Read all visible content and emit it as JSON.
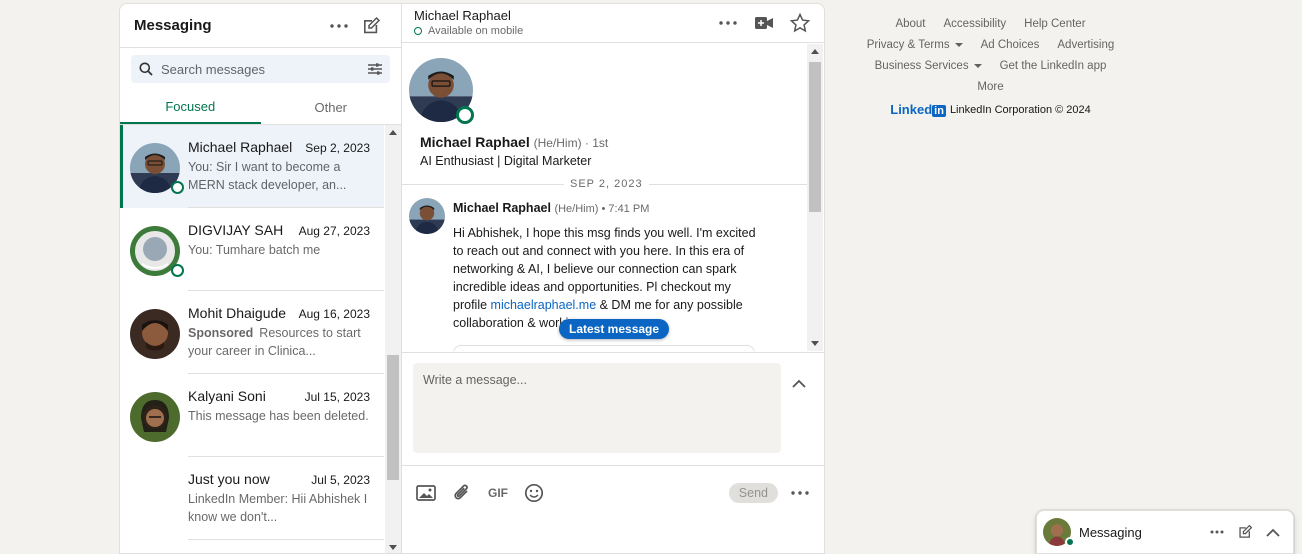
{
  "left": {
    "title": "Messaging",
    "search_placeholder": "Search messages",
    "tabs": [
      "Focused",
      "Other"
    ],
    "conversations": [
      {
        "name": "Michael Raphael",
        "date": "Sep 2, 2023",
        "snippet": "You: Sir I want to become a MERN stack developer, an...",
        "online": true
      },
      {
        "name": "DIGVIJAY SAH",
        "date": "Aug 27, 2023",
        "snippet": "You: Tumhare batch me",
        "online": true
      },
      {
        "name": "Mohit Dhaigude",
        "date": "Aug 16, 2023",
        "sponsored": "Sponsored",
        "snippet": "Resources to start your career in Clinica..."
      },
      {
        "name": "Kalyani Soni",
        "date": "Jul 15, 2023",
        "snippet": "This message has been deleted."
      },
      {
        "name": "Just you now",
        "date": "Jul 5, 2023",
        "snippet": "LinkedIn Member: Hii Abhishek I know we don't..."
      }
    ]
  },
  "thread": {
    "header_name": "Michael Raphael",
    "header_status": "Available on mobile",
    "profile_name": "Michael Raphael",
    "profile_pronouns": "(He/Him) · 1st",
    "profile_headline": "AI Enthusiast | Digital Marketer",
    "date_divider": "SEP 2, 2023",
    "message": {
      "sender": "Michael Raphael",
      "meta": "(He/Him) • 7:41 PM",
      "text_before": "Hi Abhishek, I hope this msg finds you well. I'm excited to reach out and connect with you here. In this era of networking & AI, I believe our connection can spark incredible ideas and opportunities. Pl checkout my profile ",
      "link": "michaelraphael.me",
      "text_after": " & DM me for any possible collaboration & working."
    },
    "latest_pill": "Latest message",
    "compose_placeholder": "Write a message...",
    "gif_label": "GIF",
    "send_label": "Send"
  },
  "footer": {
    "row1": [
      "About",
      "Accessibility",
      "Help Center"
    ],
    "privacy": "Privacy & Terms",
    "ad_choices": "Ad Choices",
    "advertising": "Advertising",
    "business": "Business Services",
    "get_app": "Get the LinkedIn app",
    "more": "More",
    "logo_text": "Linked",
    "logo_in": "in",
    "copyright": "LinkedIn Corporation © 2024"
  },
  "mini": {
    "title": "Messaging"
  },
  "colors": {
    "accent_green": "#01754f",
    "link_blue": "#0a66c2"
  }
}
